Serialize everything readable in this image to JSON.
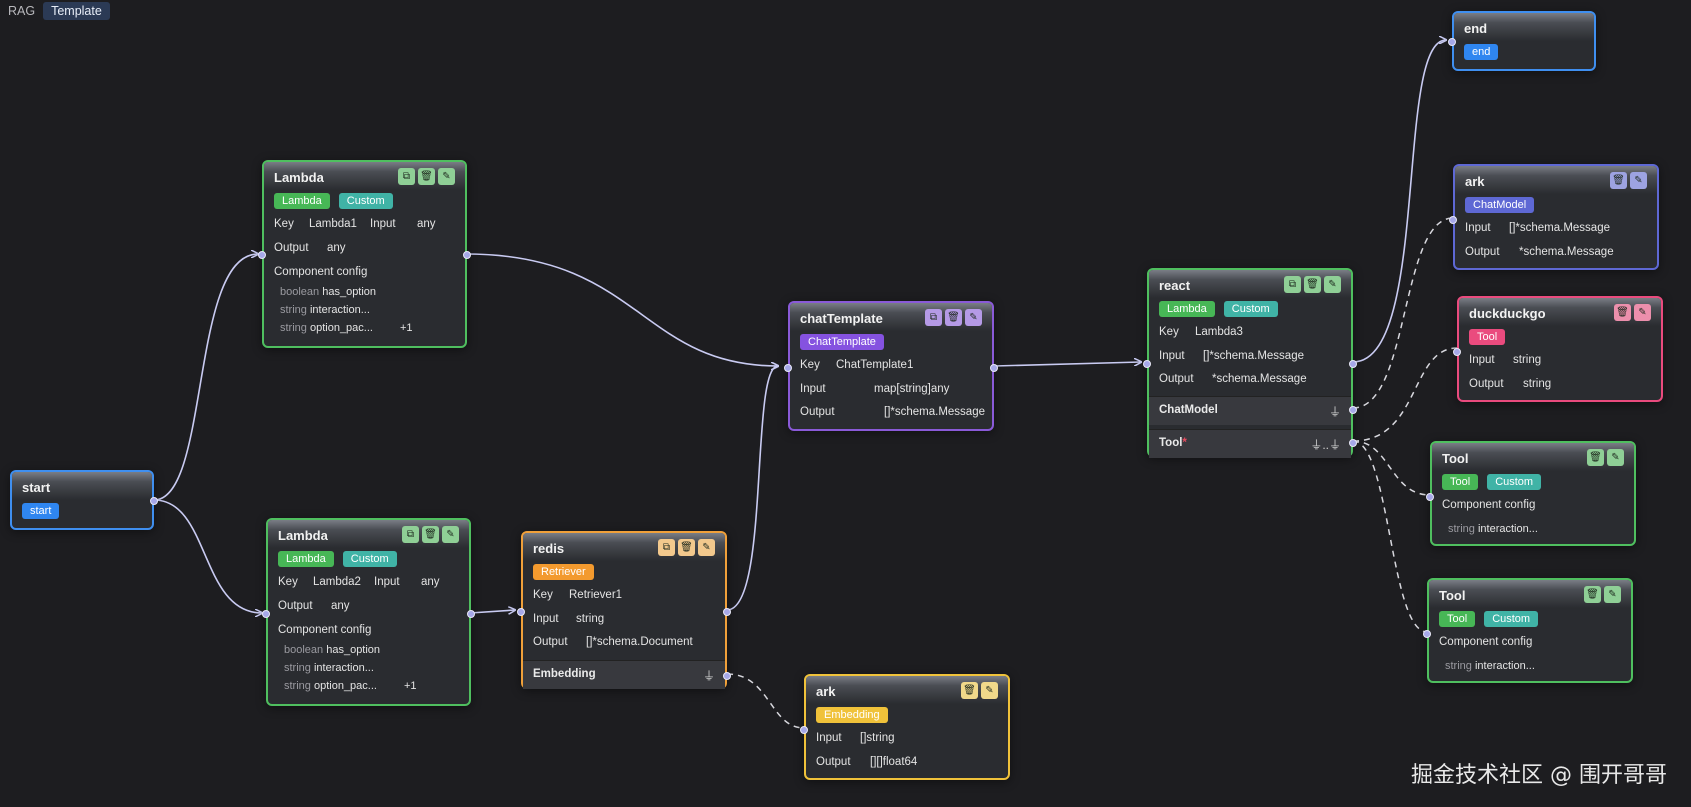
{
  "tabs": [
    "RAG",
    "Template"
  ],
  "watermark": "掘金技术社区 @ 围开哥哥",
  "labels": {
    "key": "Key",
    "input": "Input",
    "output": "Output",
    "component_config": "Component config"
  },
  "nodes": {
    "start": {
      "title": "start",
      "badge": "start"
    },
    "lambda1": {
      "title": "Lambda",
      "badges": [
        "Lambda",
        "Custom"
      ],
      "key": "Lambda1",
      "input": "any",
      "output": "any",
      "config": [
        {
          "type": "boolean",
          "name": "has_option"
        },
        {
          "type": "string",
          "name": "interaction..."
        },
        {
          "type": "string",
          "name": "option_pac..."
        }
      ],
      "more": "+1"
    },
    "lambda2": {
      "title": "Lambda",
      "badges": [
        "Lambda",
        "Custom"
      ],
      "key": "Lambda2",
      "input": "any",
      "output": "any",
      "config": [
        {
          "type": "boolean",
          "name": "has_option"
        },
        {
          "type": "string",
          "name": "interaction..."
        },
        {
          "type": "string",
          "name": "option_pac..."
        }
      ],
      "more": "+1"
    },
    "chatTemplate": {
      "title": "chatTemplate",
      "badge": "ChatTemplate",
      "key": "ChatTemplate1",
      "input": "map[string]any",
      "output": "[]*schema.Message"
    },
    "redis": {
      "title": "redis",
      "badge": "Retriever",
      "key": "Retriever1",
      "input": "string",
      "output": "[]*schema.Document",
      "section": "Embedding"
    },
    "arkEmb": {
      "title": "ark",
      "badge": "Embedding",
      "input": "[]string",
      "output": "[][]float64"
    },
    "react": {
      "title": "react",
      "badges": [
        "Lambda",
        "Custom"
      ],
      "key": "Lambda3",
      "input": "[]*schema.Message",
      "output": "*schema.Message",
      "section1": "ChatModel",
      "section2": "Tool",
      "required_mark": "*"
    },
    "end": {
      "title": "end",
      "badge": "end"
    },
    "arkChat": {
      "title": "ark",
      "badge": "ChatModel",
      "input": "[]*schema.Message",
      "output": "*schema.Message"
    },
    "duck": {
      "title": "duckduckgo",
      "badge": "Tool",
      "input": "string",
      "output": "string"
    },
    "tool1": {
      "title": "Tool",
      "badges": [
        "Tool",
        "Custom"
      ],
      "config": [
        {
          "type": "string",
          "name": "interaction..."
        }
      ]
    },
    "tool2": {
      "title": "Tool",
      "badges": [
        "Tool",
        "Custom"
      ],
      "config": [
        {
          "type": "string",
          "name": "interaction..."
        }
      ]
    }
  },
  "colors": {
    "lambda": "#47b756",
    "chatTemplate": "#8552e0",
    "retriever": "#f39a2e",
    "embedding": "#f0c23a",
    "start_end": "#2f86f0",
    "chatModel": "#5e68d4",
    "tool": "#ea4b7e",
    "edge": "#c9cbf2"
  }
}
